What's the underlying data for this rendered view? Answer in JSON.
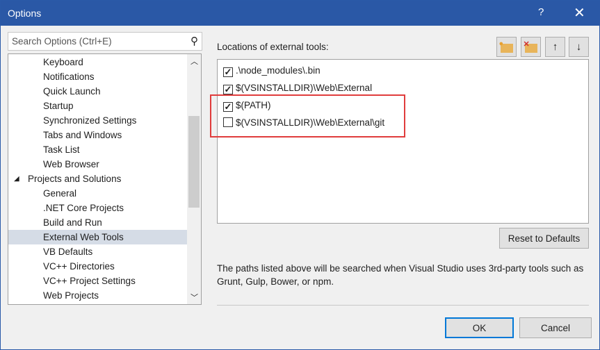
{
  "window": {
    "title": "Options",
    "help": "?",
    "close": "✕"
  },
  "search": {
    "placeholder": "Search Options (Ctrl+E)"
  },
  "tree": {
    "items": [
      {
        "label": "Keyboard",
        "level": 2
      },
      {
        "label": "Notifications",
        "level": 2
      },
      {
        "label": "Quick Launch",
        "level": 2
      },
      {
        "label": "Startup",
        "level": 2
      },
      {
        "label": "Synchronized Settings",
        "level": 2
      },
      {
        "label": "Tabs and Windows",
        "level": 2
      },
      {
        "label": "Task List",
        "level": 2
      },
      {
        "label": "Web Browser",
        "level": 2
      },
      {
        "label": "Projects and Solutions",
        "level": 1,
        "expanded": true
      },
      {
        "label": "General",
        "level": 2
      },
      {
        "label": ".NET Core Projects",
        "level": 2
      },
      {
        "label": "Build and Run",
        "level": 2
      },
      {
        "label": "External Web Tools",
        "level": 2,
        "selected": true
      },
      {
        "label": "VB Defaults",
        "level": 2
      },
      {
        "label": "VC++ Directories",
        "level": 2
      },
      {
        "label": "VC++ Project Settings",
        "level": 2
      },
      {
        "label": "Web Projects",
        "level": 2
      }
    ]
  },
  "main": {
    "label": "Locations of external tools:",
    "toolbar": [
      "add-folder-icon",
      "delete-folder-icon",
      "arrow-up-icon",
      "arrow-down-icon"
    ],
    "locations": [
      {
        "path": ".\\node_modules\\.bin",
        "checked": true
      },
      {
        "path": "$(VSINSTALLDIR)\\Web\\External",
        "checked": true
      },
      {
        "path": "$(PATH)",
        "checked": true
      },
      {
        "path": "$(VSINSTALLDIR)\\Web\\External\\git",
        "checked": false
      }
    ],
    "highlight_color": "#e03c3c",
    "reset_label": "Reset to Defaults",
    "description": "The paths listed above will be searched when Visual Studio uses 3rd-party tools such as Grunt, Gulp, Bower, or npm."
  },
  "footer": {
    "ok": "OK",
    "cancel": "Cancel"
  }
}
